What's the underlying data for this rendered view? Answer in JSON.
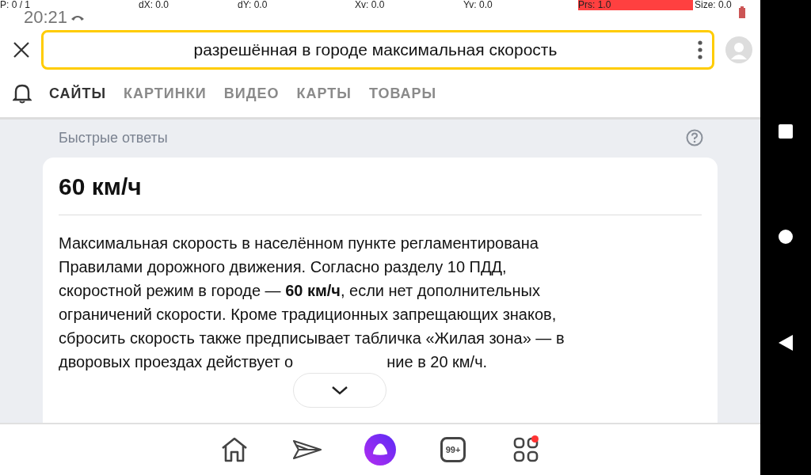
{
  "status_bar": {
    "time": "20:21"
  },
  "debug_overlay": [
    {
      "label": "P: 0 / 1",
      "highlighted": false
    },
    {
      "label": "dX: 0.0",
      "highlighted": false
    },
    {
      "label": "dY: 0.0",
      "highlighted": false
    },
    {
      "label": "Xv: 0.0",
      "highlighted": false
    },
    {
      "label": "Yv: 0.0",
      "highlighted": false
    },
    {
      "label": "Prs: 1.0",
      "highlighted": true
    },
    {
      "label": "Size: 0.0",
      "highlighted": false
    }
  ],
  "search": {
    "value": "разрешённая в городе максимальная скорость"
  },
  "tabs": [
    {
      "label": "САЙТЫ",
      "selected": true
    },
    {
      "label": "КАРТИНКИ",
      "selected": false
    },
    {
      "label": "ВИДЕО",
      "selected": false
    },
    {
      "label": "КАРТЫ",
      "selected": false
    },
    {
      "label": "ТОВАРЫ",
      "selected": false
    }
  ],
  "quick_answers": {
    "heading": "Быстрые ответы",
    "answer_title": "60 км/ч",
    "lines": [
      "Максимальная скорость в населённом пункте регламентирована",
      "Правилами дорожного движения. Согласно разделу 10 ПДД,",
      "скоростной режим в городе — **60 км/ч**, если нет дополнительных",
      "ограничений скорости. Кроме традиционных запрещающих знаков,",
      "сбросить скорость также предписывает табличка «Жилая зона» — в"
    ],
    "last_line_parts": [
      "дворовых проездах действует о",
      "ние в 20 км/ч."
    ]
  },
  "bottom_nav": {
    "tabs_badge": "99+",
    "services_notification": true
  }
}
